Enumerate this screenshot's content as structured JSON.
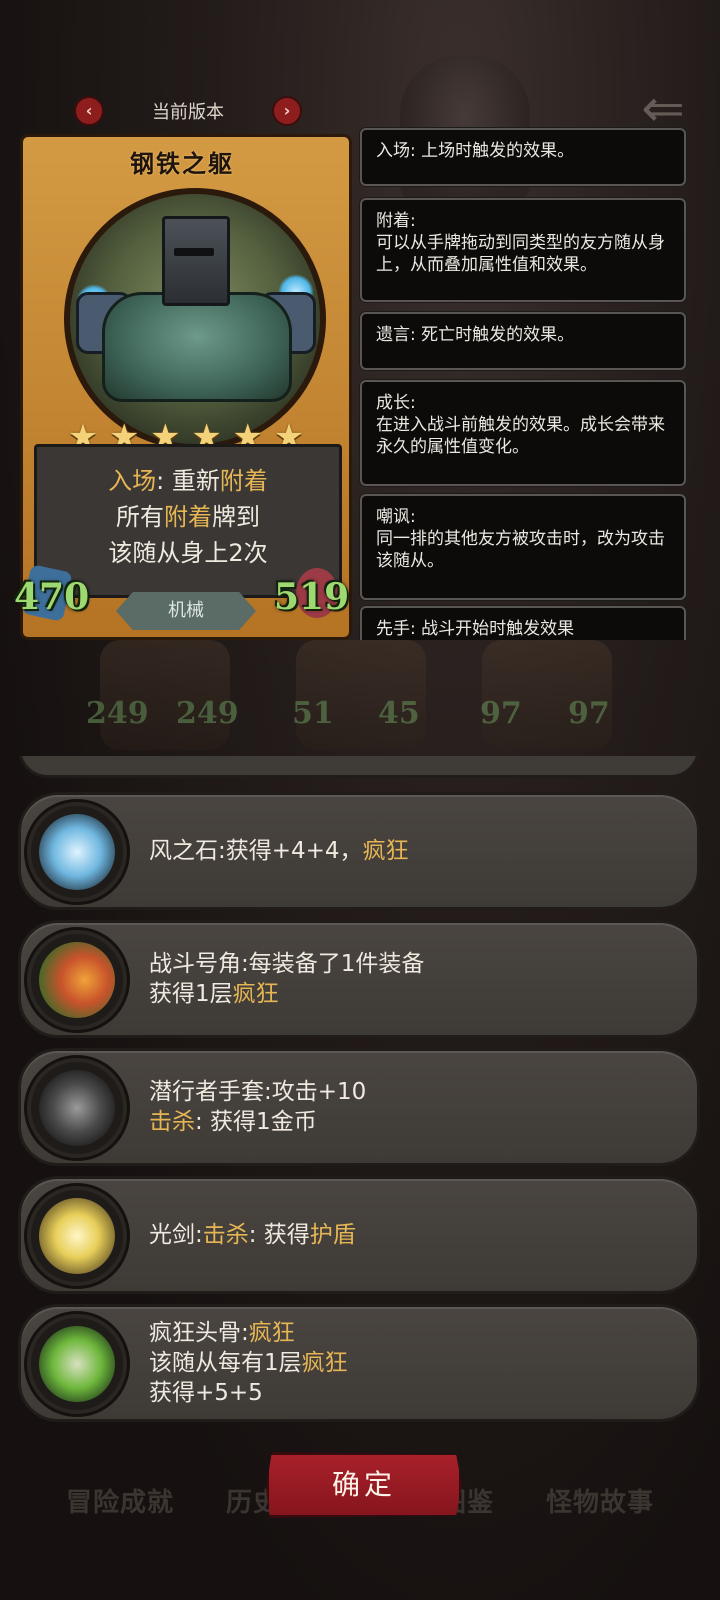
{
  "card": {
    "version_label": "当前版本",
    "prev_icon": "chevron-left-icon",
    "next_icon": "chevron-right-icon",
    "name": "钢铁之躯",
    "stars": 6,
    "effect": {
      "line1_prefix": "入场",
      "line1_rest": ": 重新",
      "line1_kw": "附着",
      "line2_prefix": "所有",
      "line2_kw": "附着",
      "line2_rest": "牌到",
      "line3": "该随从身上2次"
    },
    "attack": "470",
    "health": "519",
    "type": "机械"
  },
  "glossary": [
    {
      "title": "入场: 上场时触发的效果。",
      "body": ""
    },
    {
      "title": "附着:",
      "body": "可以从手牌拖动到同类型的友方随从身上，从而叠加属性值和效果。"
    },
    {
      "title": "遗言: 死亡时触发的效果。",
      "body": ""
    },
    {
      "title": "成长:",
      "body": "在进入战斗前触发的效果。成长会带来永久的属性值变化。"
    },
    {
      "title": "嘲讽:",
      "body": "同一排的其他友方被攻击时，改为攻击该随从。"
    },
    {
      "title": "先手: 战斗开始时触发效果",
      "body": ""
    }
  ],
  "board": [
    {
      "atk": "249",
      "hp": "249"
    },
    {
      "atk": "51",
      "hp": "45"
    },
    {
      "atk": "97",
      "hp": "97"
    }
  ],
  "equipment": [
    {
      "icon": "wind-stone-icon",
      "color": "#6fb7e0",
      "line1_a": "风之石:获得+4+4，",
      "line1_kw": "疯狂",
      "line1_b": "",
      "line2_kw": "",
      "line2_b": "",
      "line3": ""
    },
    {
      "icon": "war-horn-icon",
      "color": "#c8532b",
      "line1_a": "战斗号角:每装备了1件装备",
      "line1_kw": "",
      "line1_b": "",
      "line2_a": "获得1层",
      "line2_kw": "疯狂",
      "line2_b": "",
      "line3": ""
    },
    {
      "icon": "glove-icon",
      "color": "#8c8c8c",
      "line1_a": "潜行者手套:攻击+10",
      "line1_kw": "",
      "line1_b": "",
      "line2_a": "",
      "line2_kw": "击杀",
      "line2_b": ": 获得1金币",
      "line3": ""
    },
    {
      "icon": "light-sword-icon",
      "color": "#e8cf5a",
      "line1_a": "光剑:",
      "line1_kw": "击杀",
      "line1_b": ": 获得",
      "line1_kw2": "护盾",
      "line2_a": "",
      "line2_kw": "",
      "line2_b": "",
      "line3": ""
    },
    {
      "icon": "skull-icon",
      "color": "#6fb83d",
      "line1_a": "疯狂头骨:",
      "line1_kw": "疯狂",
      "line1_b": "",
      "line2_a": "该随从每有1层",
      "line2_kw": "疯狂",
      "line2_b": "",
      "line3": "获得+5+5"
    }
  ],
  "tabs": [
    "冒险成就",
    "历史卡组",
    "卡牌图鉴",
    "怪物故事"
  ],
  "confirm_label": "确定",
  "colors": {
    "keyword": "#e6b655",
    "stat": "#9ed870",
    "confirm": "#a8202a"
  }
}
